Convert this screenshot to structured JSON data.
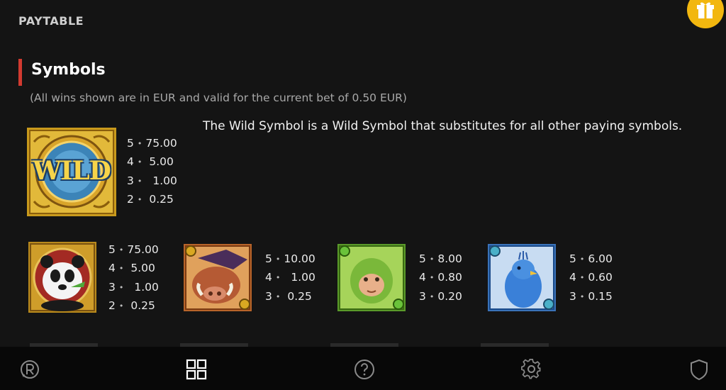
{
  "header": {
    "title": "PAYTABLE"
  },
  "section": {
    "title": "Symbols",
    "subtitle": "(All wins shown are in EUR and valid for the current bet of 0.50 EUR)"
  },
  "wild": {
    "icon": "wild-symbol-icon",
    "label": "WILD",
    "description": "The Wild Symbol is a Wild Symbol that substitutes for all other paying symbols.",
    "pays": [
      {
        "count": "5",
        "value": "75.00"
      },
      {
        "count": "4",
        "value": "5.00"
      },
      {
        "count": "3",
        "value": "1.00"
      },
      {
        "count": "2",
        "value": "0.25"
      }
    ]
  },
  "symbols": [
    {
      "icon": "panda-symbol-icon",
      "pays": [
        {
          "count": "5",
          "value": "75.00"
        },
        {
          "count": "4",
          "value": "5.00"
        },
        {
          "count": "3",
          "value": "1.00"
        },
        {
          "count": "2",
          "value": "0.25"
        }
      ]
    },
    {
      "icon": "boar-symbol-icon",
      "pays": [
        {
          "count": "5",
          "value": "10.00"
        },
        {
          "count": "4",
          "value": "1.00"
        },
        {
          "count": "3",
          "value": "0.25"
        }
      ]
    },
    {
      "icon": "monkey-symbol-icon",
      "pays": [
        {
          "count": "5",
          "value": "8.00"
        },
        {
          "count": "4",
          "value": "0.80"
        },
        {
          "count": "3",
          "value": "0.20"
        }
      ]
    },
    {
      "icon": "peacock-symbol-icon",
      "pays": [
        {
          "count": "5",
          "value": "6.00"
        },
        {
          "count": "4",
          "value": "0.60"
        },
        {
          "count": "3",
          "value": "0.15"
        }
      ]
    }
  ],
  "nav": [
    "responsible-gaming-icon",
    "paytable-grid-icon",
    "help-icon",
    "settings-gear-icon",
    "shield-icon"
  ],
  "colors": {
    "accent_red": "#d23a30",
    "gift_gold": "#f2b70f",
    "background": "#141414",
    "bottom_bar": "#080808"
  }
}
